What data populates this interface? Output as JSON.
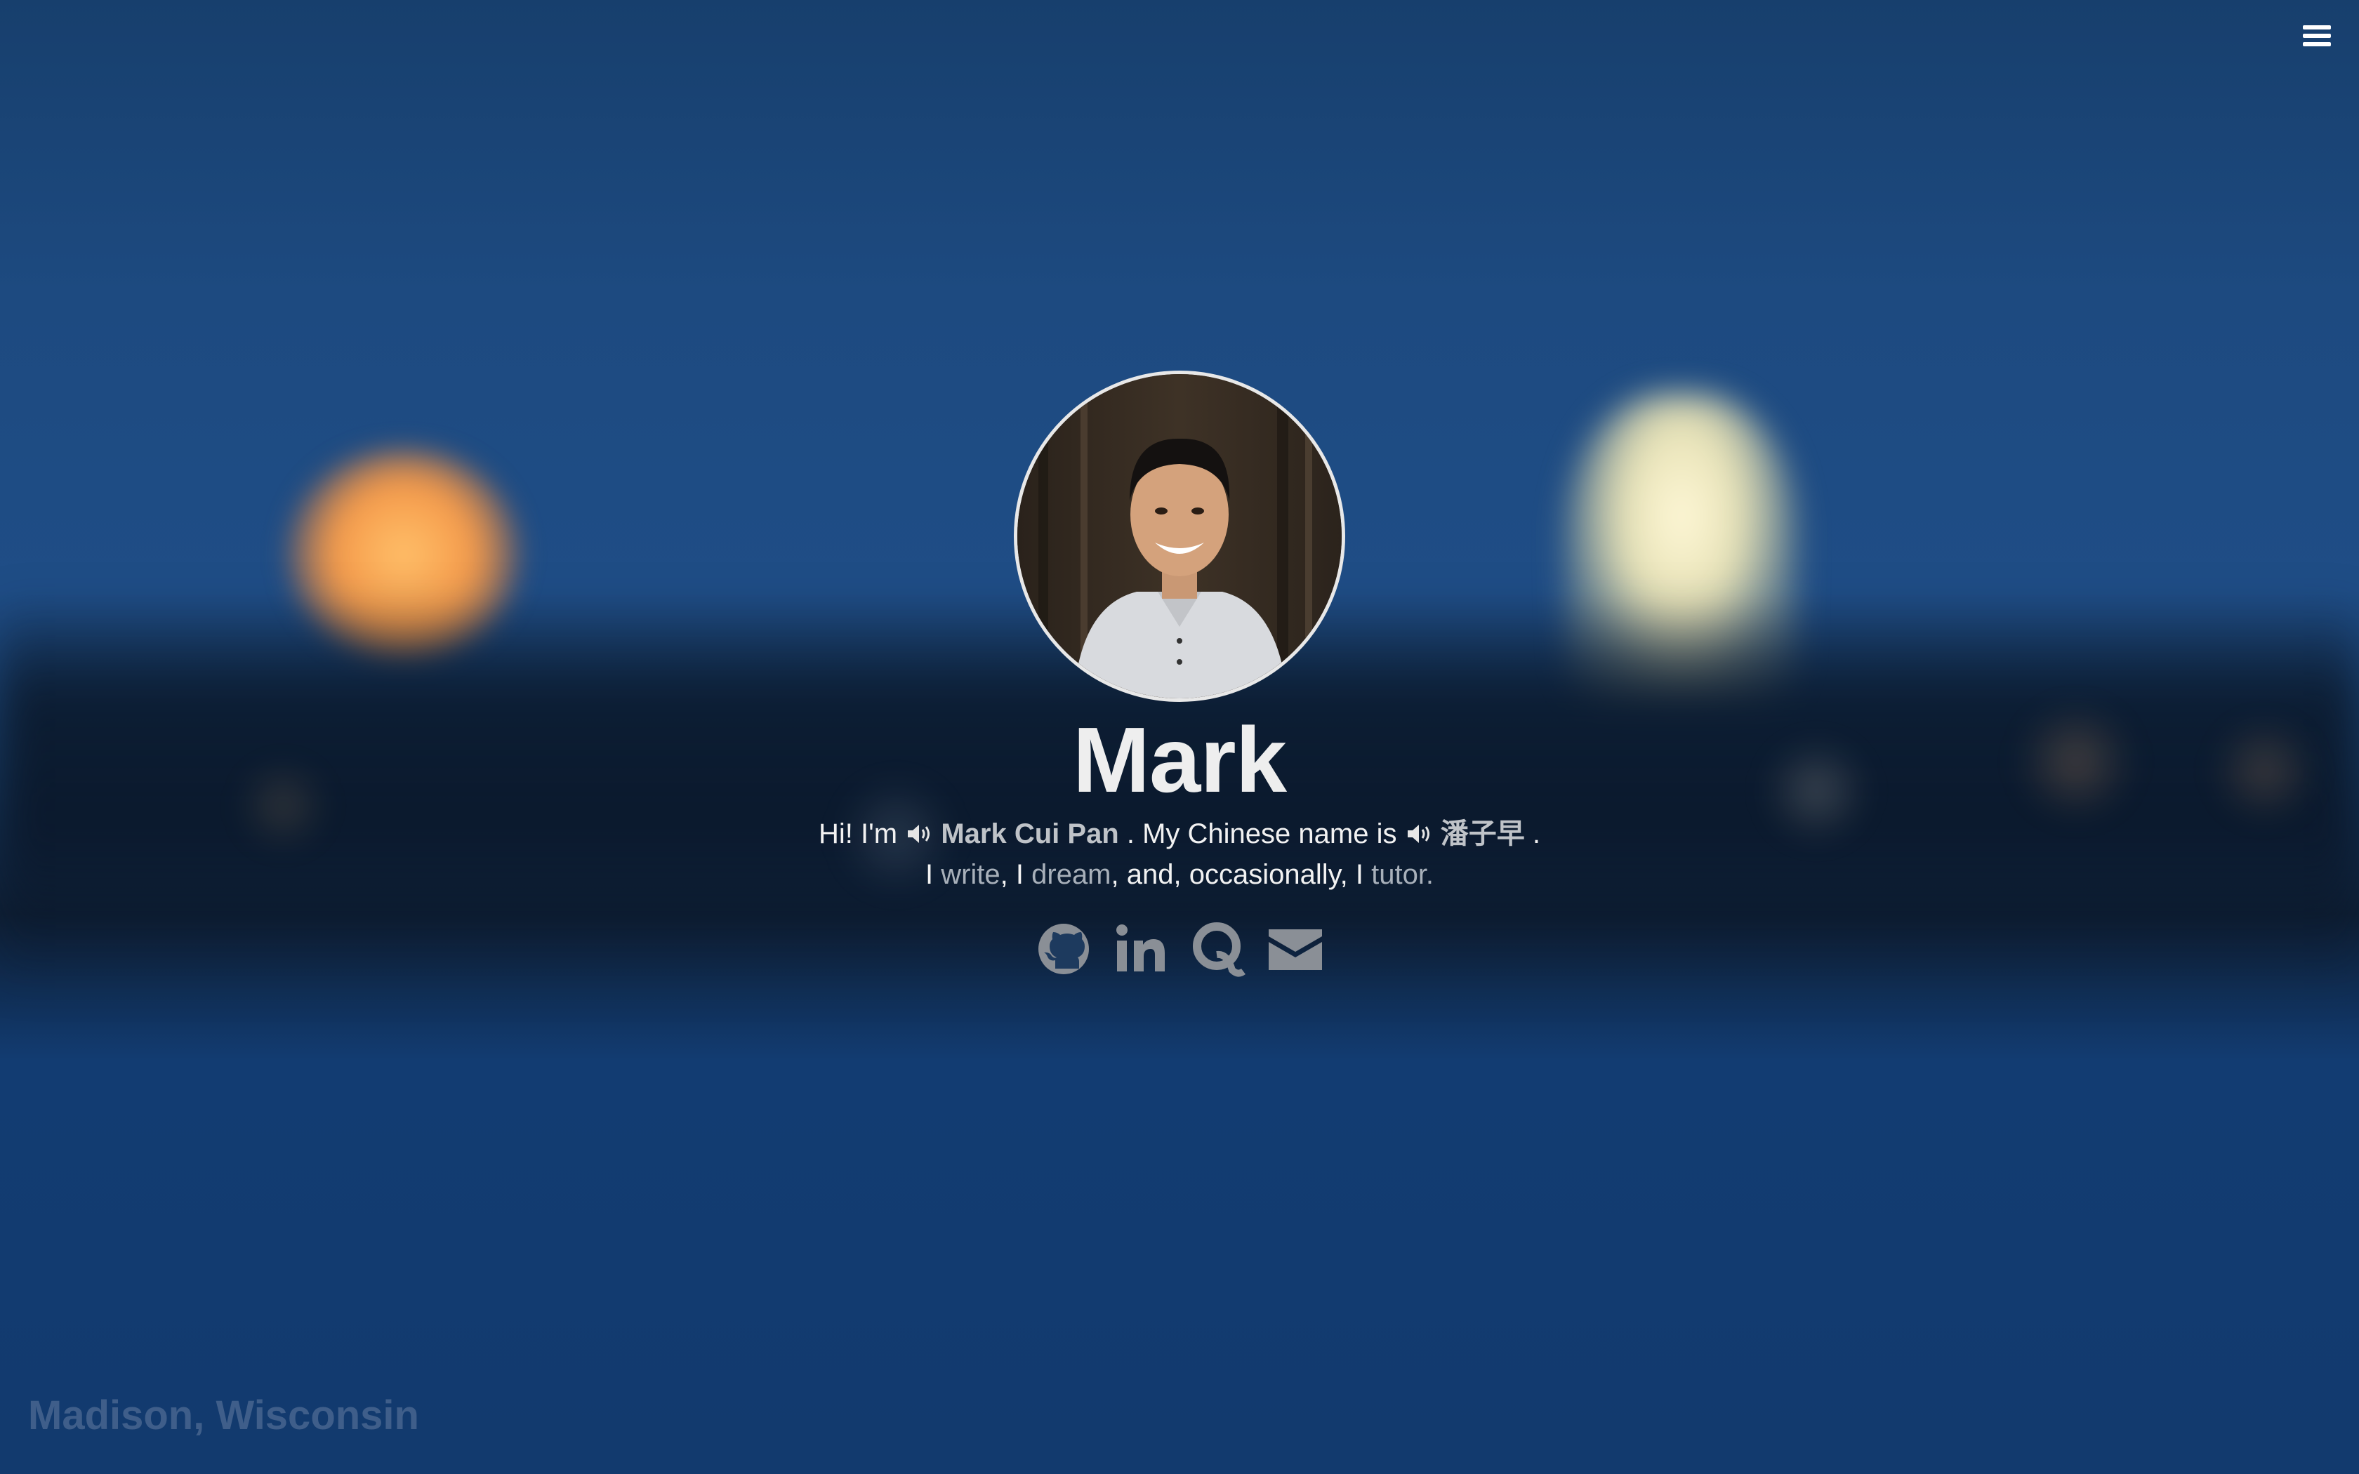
{
  "menu": {
    "icon": "hamburger-menu-icon"
  },
  "profile": {
    "name": "Mark",
    "intro": {
      "greeting": "Hi! I'm",
      "full_name": "Mark Cui Pan",
      "middle": ". My Chinese name is",
      "chinese_name": "潘子早",
      "end": "."
    },
    "activities": {
      "prefix": "I",
      "write": "write",
      "sep1": ", I",
      "dream": "dream",
      "sep2": ", and, occasionally, I",
      "tutor": "tutor."
    }
  },
  "social": [
    {
      "name": "github",
      "icon": "github-icon"
    },
    {
      "name": "linkedin",
      "icon": "linkedin-icon"
    },
    {
      "name": "quora",
      "icon": "quora-icon"
    },
    {
      "name": "email",
      "icon": "envelope-icon"
    }
  ],
  "location": "Madison, Wisconsin",
  "colors": {
    "background": "#1f4d86",
    "text": "#f2f2f2",
    "muted": "#a8b0ba",
    "icons": "#8a8f96"
  }
}
